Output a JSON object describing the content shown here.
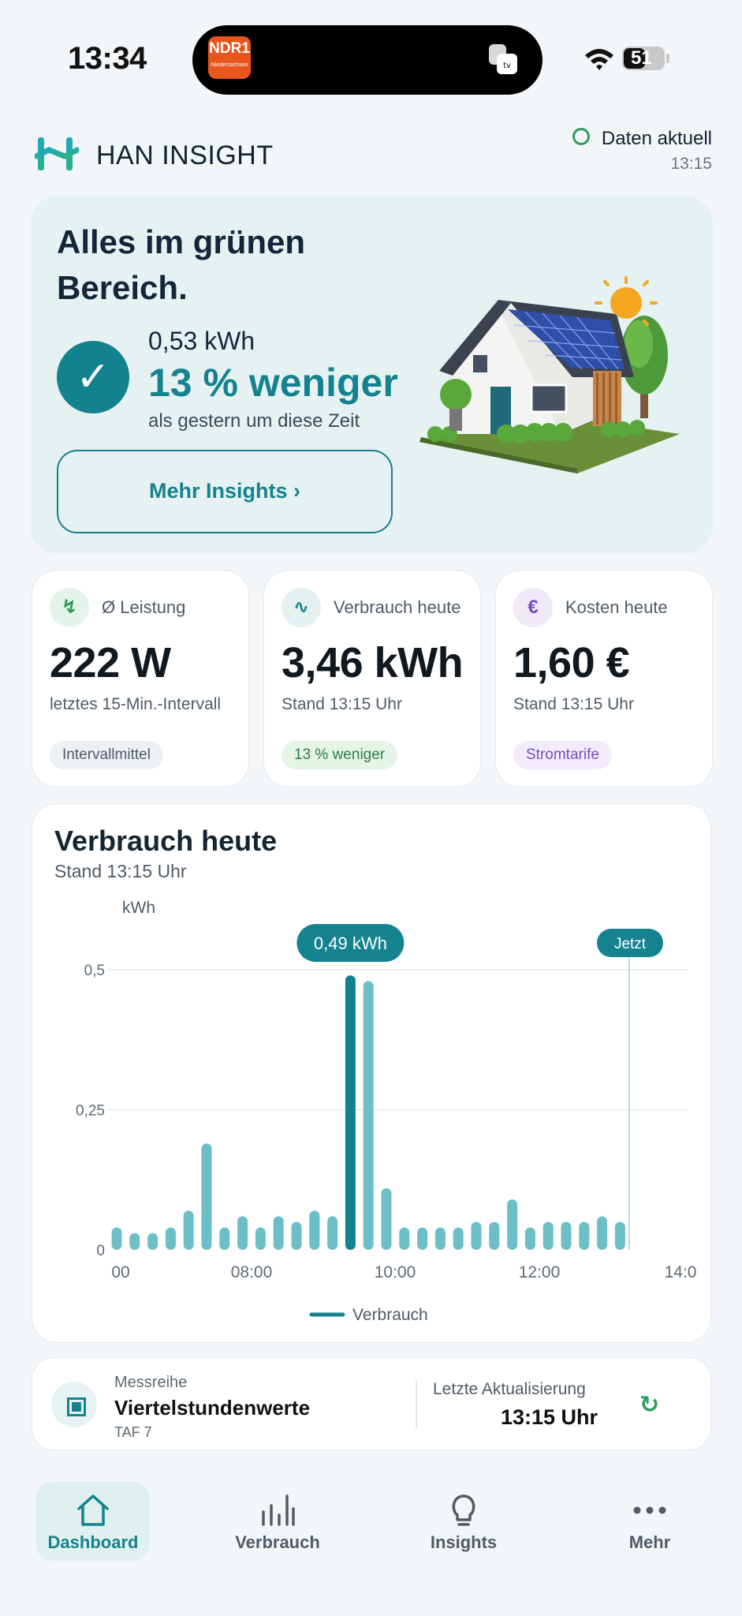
{
  "status_bar": {
    "time": "13:34",
    "radio_station": "NDR1",
    "radio_region": "Niedersachsen",
    "battery": "51"
  },
  "header": {
    "app_title": "HAN INSIGHT",
    "data_status": "Daten aktuell",
    "data_time": "13:15"
  },
  "hero": {
    "title": "Alles im grünen Bereich.",
    "kwh": "0,53 kWh",
    "percent": "13 % weniger",
    "comparison": "als gestern um diese Zeit",
    "button": "Mehr Insights ›"
  },
  "stats": [
    {
      "icon": "↯",
      "icon_name": "bolt-icon",
      "label": "Ø Leistung",
      "value": "222 W",
      "desc": "letztes 15-Min.-Intervall",
      "chip": "Intervallmittel",
      "icon_color": "#2e9d5a",
      "icon_bg": "#e5f4ea",
      "chip_bg": "#eef1f4",
      "chip_color": "#4f5b67"
    },
    {
      "icon": "∿",
      "icon_name": "wave-icon",
      "label": "Verbrauch heute",
      "value": "3,46 kWh",
      "desc": "Stand 13:15 Uhr",
      "chip": "13 % weniger",
      "icon_color": "#15838f",
      "icon_bg": "#e3f1f1",
      "chip_bg": "#e4f4e7",
      "chip_color": "#2a7d45"
    },
    {
      "icon": "€",
      "icon_name": "euro-icon",
      "label": "Kosten heute",
      "value": "1,60 €",
      "desc": "Stand 13:15 Uhr",
      "chip": "Stromtarife",
      "icon_color": "#7a4fc0",
      "icon_bg": "#efe9f8",
      "chip_bg": "#f1ebfb",
      "chip_color": "#7a4fc0"
    }
  ],
  "chart": {
    "title": "Verbrauch heute",
    "subtitle": "Stand 13:15 Uhr",
    "tooltip": "0,49 kWh",
    "now_label": "Jetzt",
    "legend": "Verbrauch"
  },
  "chart_data": {
    "type": "bar",
    "ylabel": "kWh",
    "ylim": [
      0,
      0.5
    ],
    "yticks": [
      "0",
      "0,25",
      "0,5"
    ],
    "xticks": [
      "00",
      "08:00",
      "10:00",
      "12:00",
      "14:0"
    ],
    "series": [
      {
        "name": "Verbrauch",
        "values": [
          0.04,
          0.03,
          0.03,
          0.04,
          0.07,
          0.19,
          0.04,
          0.06,
          0.04,
          0.06,
          0.05,
          0.07,
          0.06,
          0.49,
          0.48,
          0.11,
          0.04,
          0.04,
          0.04,
          0.04,
          0.05,
          0.05,
          0.09,
          0.04,
          0.05,
          0.05,
          0.05,
          0.06,
          0.05
        ]
      }
    ],
    "highlight_index": 13,
    "grid": "horizontal",
    "legend_position": "bottom",
    "colors": {
      "bar": "#6cbfc6",
      "highlight": "#12828f"
    }
  },
  "source": {
    "label": "Messreihe",
    "title": "Viertelstundenwerte",
    "sub": "TAF 7",
    "update_label": "Letzte Aktualisierung",
    "update_time": "13:15 Uhr"
  },
  "nav": [
    {
      "label": "Dashboard",
      "icon": "home-icon",
      "active": true
    },
    {
      "label": "Verbrauch",
      "icon": "bar-chart-icon",
      "active": false
    },
    {
      "label": "Insights",
      "icon": "lightbulb-icon",
      "active": false
    },
    {
      "label": "Mehr",
      "icon": "more-icon",
      "active": false
    }
  ],
  "colors": {
    "accent": "#15838f",
    "positive": "#2e9d5a",
    "background": "#f3f6f9"
  }
}
